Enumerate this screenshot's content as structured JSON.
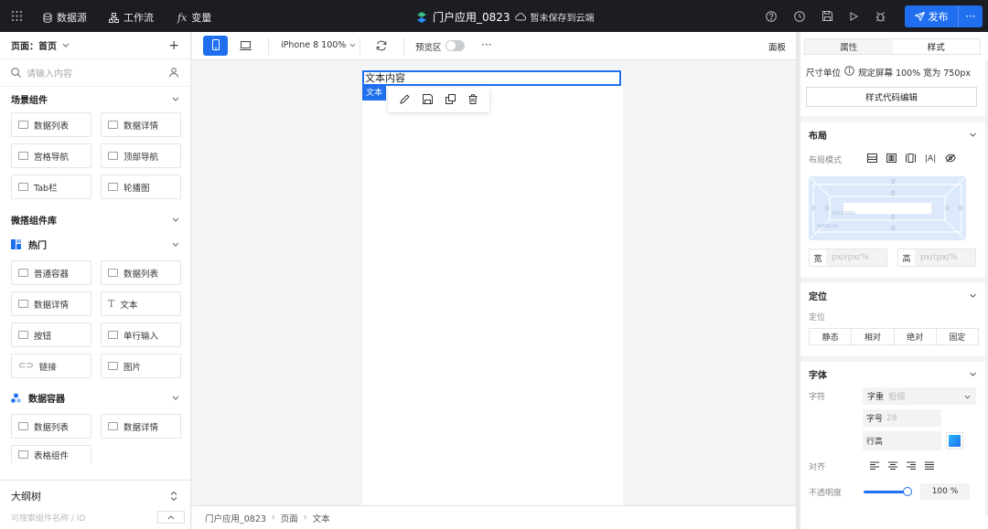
{
  "topbar": {
    "datasource": "数据源",
    "workflow": "工作流",
    "variables": "变量",
    "app_title": "门户应用_0823",
    "save_status": "暂未保存到云端",
    "publish": "发布"
  },
  "left_panel": {
    "page_label": "页面：首页",
    "search_placeholder": "请输入内容",
    "scene_section": "场景组件",
    "scene_items": [
      "数据列表",
      "数据详情",
      "宫格导航",
      "顶部导航",
      "Tab栏",
      "轮播图"
    ],
    "library_section": "微搭组件库",
    "hot_section": "热门",
    "hot_items": [
      "普通容器",
      "数据列表",
      "数据详情",
      "文本",
      "按钮",
      "单行输入",
      "链接",
      "图片"
    ],
    "data_section": "数据容器",
    "data_items": [
      "数据列表",
      "数据详情",
      "表格组件"
    ],
    "outline_title": "大纲树",
    "outline_placeholder": "可搜索组件名称 / ID"
  },
  "toolbar": {
    "device": "iPhone 8 100%",
    "preview": "预览区",
    "panel": "面板"
  },
  "canvas": {
    "text_content": "文本内容",
    "selected_tag": "文本"
  },
  "breadcrumb": {
    "app": "门户应用_0823",
    "page": "页面",
    "component": "文本"
  },
  "right_panel": {
    "tab_props": "属性",
    "tab_style": "样式",
    "unit_label": "尺寸单位",
    "unit_value": "规定屏幕 100% 宽为 750px",
    "style_code_btn": "样式代码编辑",
    "layout_section": "布局",
    "layout_mode": "布局模式",
    "box_values": [
      "0",
      "0",
      "0",
      "0",
      "0",
      "0",
      "0",
      "0"
    ],
    "padding_label": "PADDING",
    "margin_label": "MARGIN",
    "width_label": "宽",
    "height_label": "高",
    "size_placeholder": "px/rpx/%",
    "position_section": "定位",
    "position_label": "定位",
    "position_options": [
      "静态",
      "相对",
      "绝对",
      "固定"
    ],
    "font_section": "字体",
    "font_label": "字符",
    "weight_label": "字重",
    "weight_value": "粗细",
    "size_label": "字号",
    "size_value": "28",
    "line_height_label": "行高",
    "align_label": "对齐",
    "opacity_label": "不透明度",
    "opacity_value": "100 %"
  },
  "colors": {
    "accent": "#1f6fef",
    "topbar": "#1b1d22"
  }
}
